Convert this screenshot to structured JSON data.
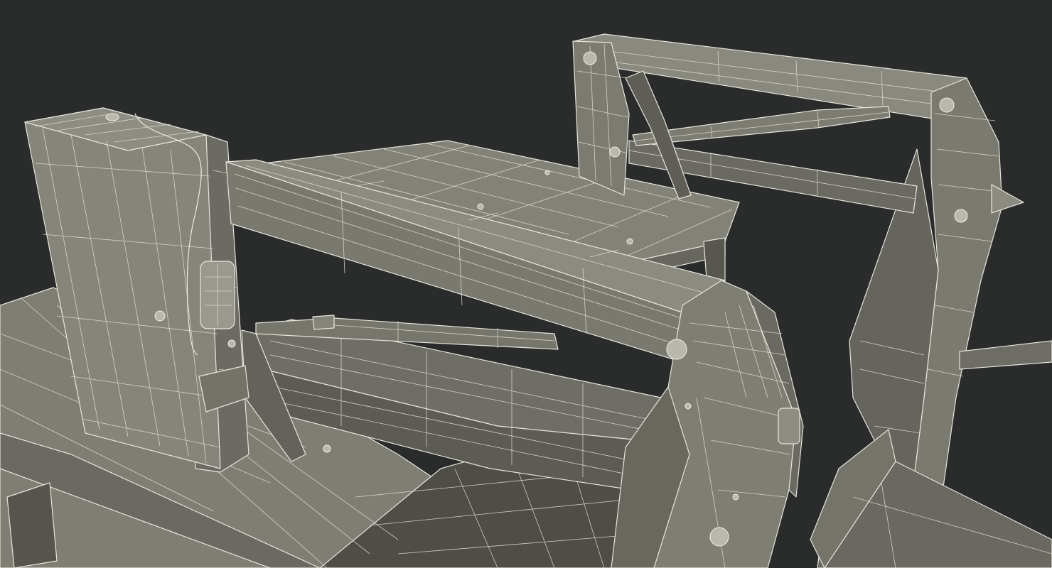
{
  "scene": {
    "background": "#2a2b2b",
    "colors": {
      "metal_light": "#8a897f",
      "metal_mid": "#77766d",
      "metal_dark": "#5e5d56",
      "metal_shadow": "#46453f",
      "wire": "#e7e6dc"
    }
  }
}
